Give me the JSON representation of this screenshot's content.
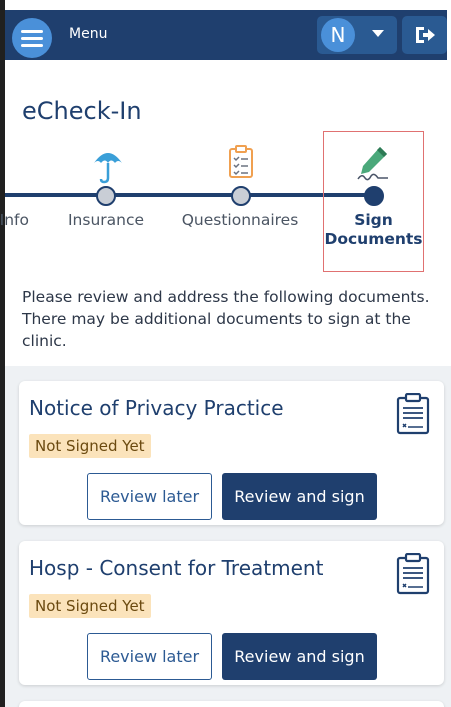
{
  "header": {
    "menu_label": "Menu",
    "user_initial": "N"
  },
  "page": {
    "title": "eCheck-In",
    "intro": "Please review and address the following documents. There may be additional documents to sign at the clinic."
  },
  "stepper": {
    "steps": [
      {
        "label": "Info",
        "state": "complete"
      },
      {
        "label": "Insurance",
        "state": "complete",
        "icon": "umbrella-icon"
      },
      {
        "label": "Questionnaires",
        "state": "complete",
        "icon": "clipboard-checklist-icon"
      },
      {
        "label": "Sign Documents",
        "state": "current",
        "icon": "pen-signature-icon"
      }
    ]
  },
  "documents": [
    {
      "title": "Notice of Privacy Practice",
      "status": "Not Signed Yet",
      "later_label": "Review later",
      "sign_label": "Review and sign",
      "icon": "clipboard-document-icon"
    },
    {
      "title": "Hosp - Consent for Treatment",
      "status": "Not Signed Yet",
      "later_label": "Review later",
      "sign_label": "Review and sign",
      "icon": "clipboard-document-icon"
    }
  ],
  "colors": {
    "navy": "#1f3f6e",
    "accent_blue": "#4a90d9",
    "badge_bg": "#fbe3bb",
    "highlight_border": "#e07171"
  }
}
